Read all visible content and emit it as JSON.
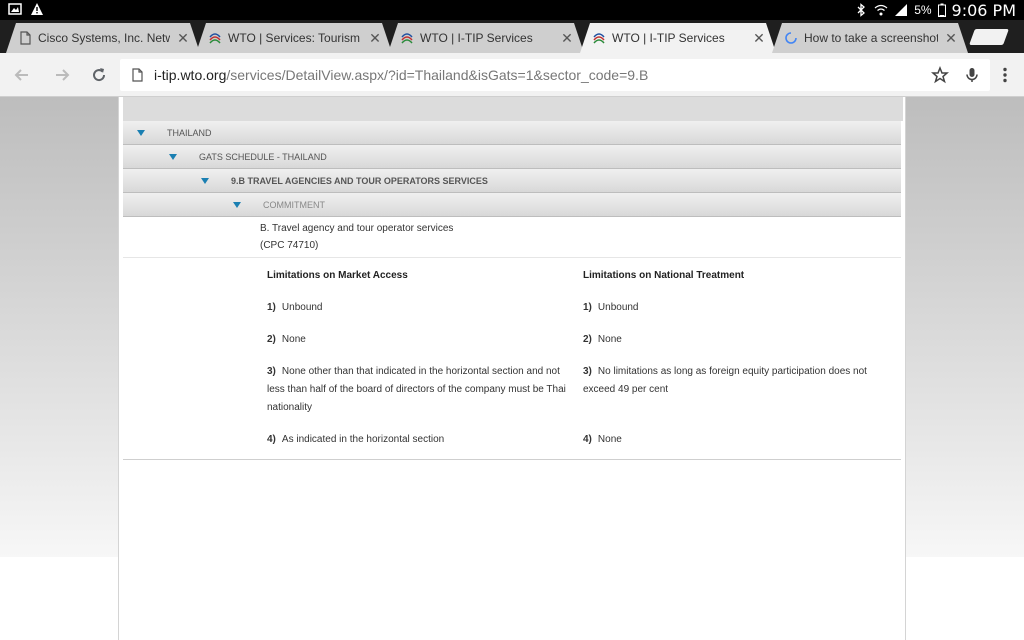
{
  "status_bar": {
    "battery": "5%",
    "time": "9:06 PM"
  },
  "tabs": [
    {
      "title": "Cisco Systems, Inc. Networ",
      "favicon": "page-icon",
      "active": false
    },
    {
      "title": "WTO | Services: Tourism an",
      "favicon": "wto-icon",
      "active": false
    },
    {
      "title": "WTO | I-TIP Services",
      "favicon": "wto-icon",
      "active": false
    },
    {
      "title": "WTO | I-TIP Services",
      "favicon": "wto-icon",
      "active": true
    },
    {
      "title": "How to take a screenshot o",
      "favicon": "loading-spinner-icon",
      "active": false
    }
  ],
  "toolbar": {
    "url_host": "i-tip.wto.org",
    "url_path": "/services/DetailView.aspx/?id=Thailand&isGats=1&sector_code=9.B"
  },
  "tree": {
    "level1": "THAILAND",
    "level2": "GATS SCHEDULE - THAILAND",
    "level3": "9.B TRAVEL AGENCIES AND TOUR OPERATORS SERVICES",
    "level4": "COMMITMENT"
  },
  "sector": {
    "line1": "B. Travel agency and tour operator services",
    "line2": "(CPC 74710)"
  },
  "market_access": {
    "heading": "Limitations on Market Access",
    "items": [
      {
        "num": "1)",
        "text": "Unbound"
      },
      {
        "num": "2)",
        "text": "None"
      },
      {
        "num": "3)",
        "text": "None other than that indicated in the horizontal section and not less than half of the board of directors of the company must be Thai nationality"
      },
      {
        "num": "4)",
        "text": "As indicated in the horizontal section"
      }
    ]
  },
  "national_treatment": {
    "heading": "Limitations on National Treatment",
    "items": [
      {
        "num": "1)",
        "text": "Unbound"
      },
      {
        "num": "2)",
        "text": "None"
      },
      {
        "num": "3)",
        "text": "No limitations as long as foreign equity participation does not exceed 49 per cent"
      },
      {
        "num": "4)",
        "text": "None"
      }
    ]
  }
}
